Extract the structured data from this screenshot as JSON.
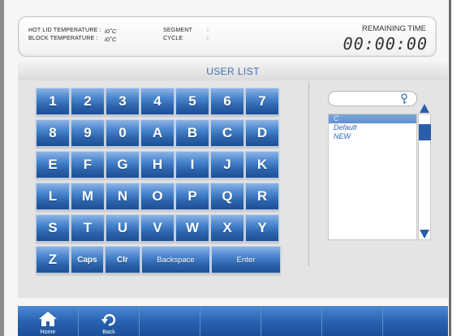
{
  "header": {
    "hot_lid_label": "HOT LID TEMPERATURE :",
    "hot_lid_value": "i0˚C",
    "block_label": "BLOCK TEMPERATURE :",
    "block_value": "i0˚C",
    "segment_label": "SEGMENT",
    "segment_sep": ":",
    "cycle_label": "CYCLE",
    "cycle_sep": ":",
    "remaining_label": "REMAINING TIME",
    "remaining_value": "00:00:00"
  },
  "panel": {
    "title": "USER LIST"
  },
  "keypad": {
    "rows": [
      [
        "1",
        "2",
        "3",
        "4",
        "5",
        "6",
        "7"
      ],
      [
        "8",
        "9",
        "0",
        "A",
        "B",
        "C",
        "D"
      ],
      [
        "E",
        "F",
        "G",
        "H",
        "I",
        "J",
        "K"
      ],
      [
        "L",
        "M",
        "N",
        "O",
        "P",
        "Q",
        "R"
      ],
      [
        "S",
        "T",
        "U",
        "V",
        "W",
        "X",
        "Y"
      ]
    ],
    "last_row": {
      "z": "Z",
      "caps": "Caps",
      "clr": "Clr",
      "backspace": "Backspace",
      "enter": "Enter"
    }
  },
  "user_list": {
    "search_value": "",
    "items": [
      "C",
      "Default",
      "NEW"
    ],
    "selected_index": 0
  },
  "nav": {
    "home_label": "Home",
    "back_label": "Back"
  },
  "colors": {
    "accent": "#2a62ab",
    "title": "#3a6fb0",
    "list_text": "#2e62b8"
  }
}
